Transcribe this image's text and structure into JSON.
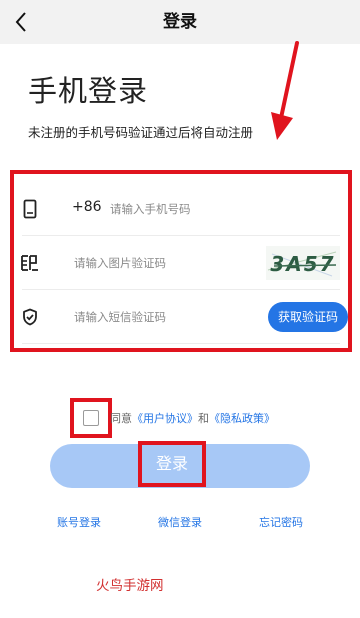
{
  "header": {
    "title": "登录"
  },
  "main": {
    "title": "手机登录",
    "subtitle": "未注册的手机号码验证通过后将自动注册"
  },
  "form": {
    "phone": {
      "country_code": "+86",
      "placeholder": "请输入手机号码",
      "value": ""
    },
    "image_code": {
      "placeholder": "请输入图片验证码",
      "value": "",
      "captcha_text": "3A57"
    },
    "sms_code": {
      "placeholder": "请输入短信验证码",
      "value": "",
      "button_label": "获取验证码"
    }
  },
  "agreement": {
    "checked": false,
    "prefix": "同意",
    "user_agreement": "《用户协议》",
    "conjunction": "和",
    "privacy_policy": "《隐私政策》"
  },
  "login_button": {
    "label": "登录"
  },
  "links": {
    "account_login": "账号登录",
    "wechat_login": "微信登录",
    "forgot_password": "忘记密码"
  },
  "watermark": "火鸟手游网",
  "colors": {
    "accent": "#2475e5",
    "annotation_red": "#e0141e",
    "login_button_disabled": "#a7c8f6",
    "header_bg": "#f2f2f2"
  }
}
